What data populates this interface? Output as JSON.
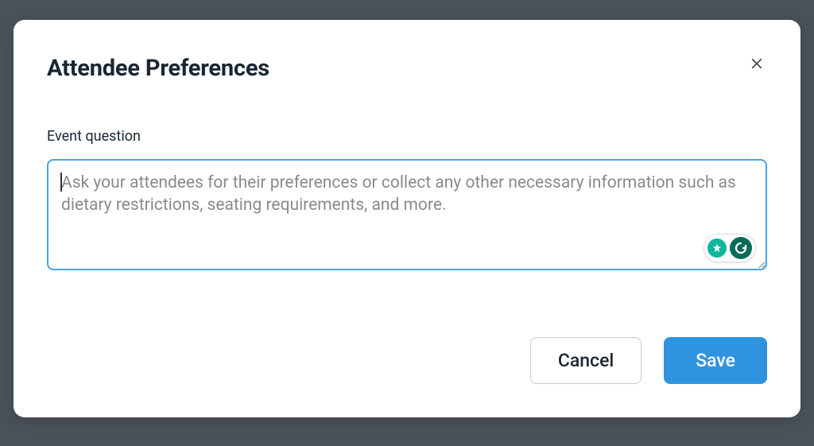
{
  "modal": {
    "title": "Attendee Preferences",
    "field_label": "Event question",
    "textarea": {
      "value": "",
      "placeholder": "Ask your attendees for their preferences or collect any other necessary information such as dietary restrictions, seating requirements, and more."
    },
    "buttons": {
      "cancel": "Cancel",
      "save": "Save"
    }
  }
}
